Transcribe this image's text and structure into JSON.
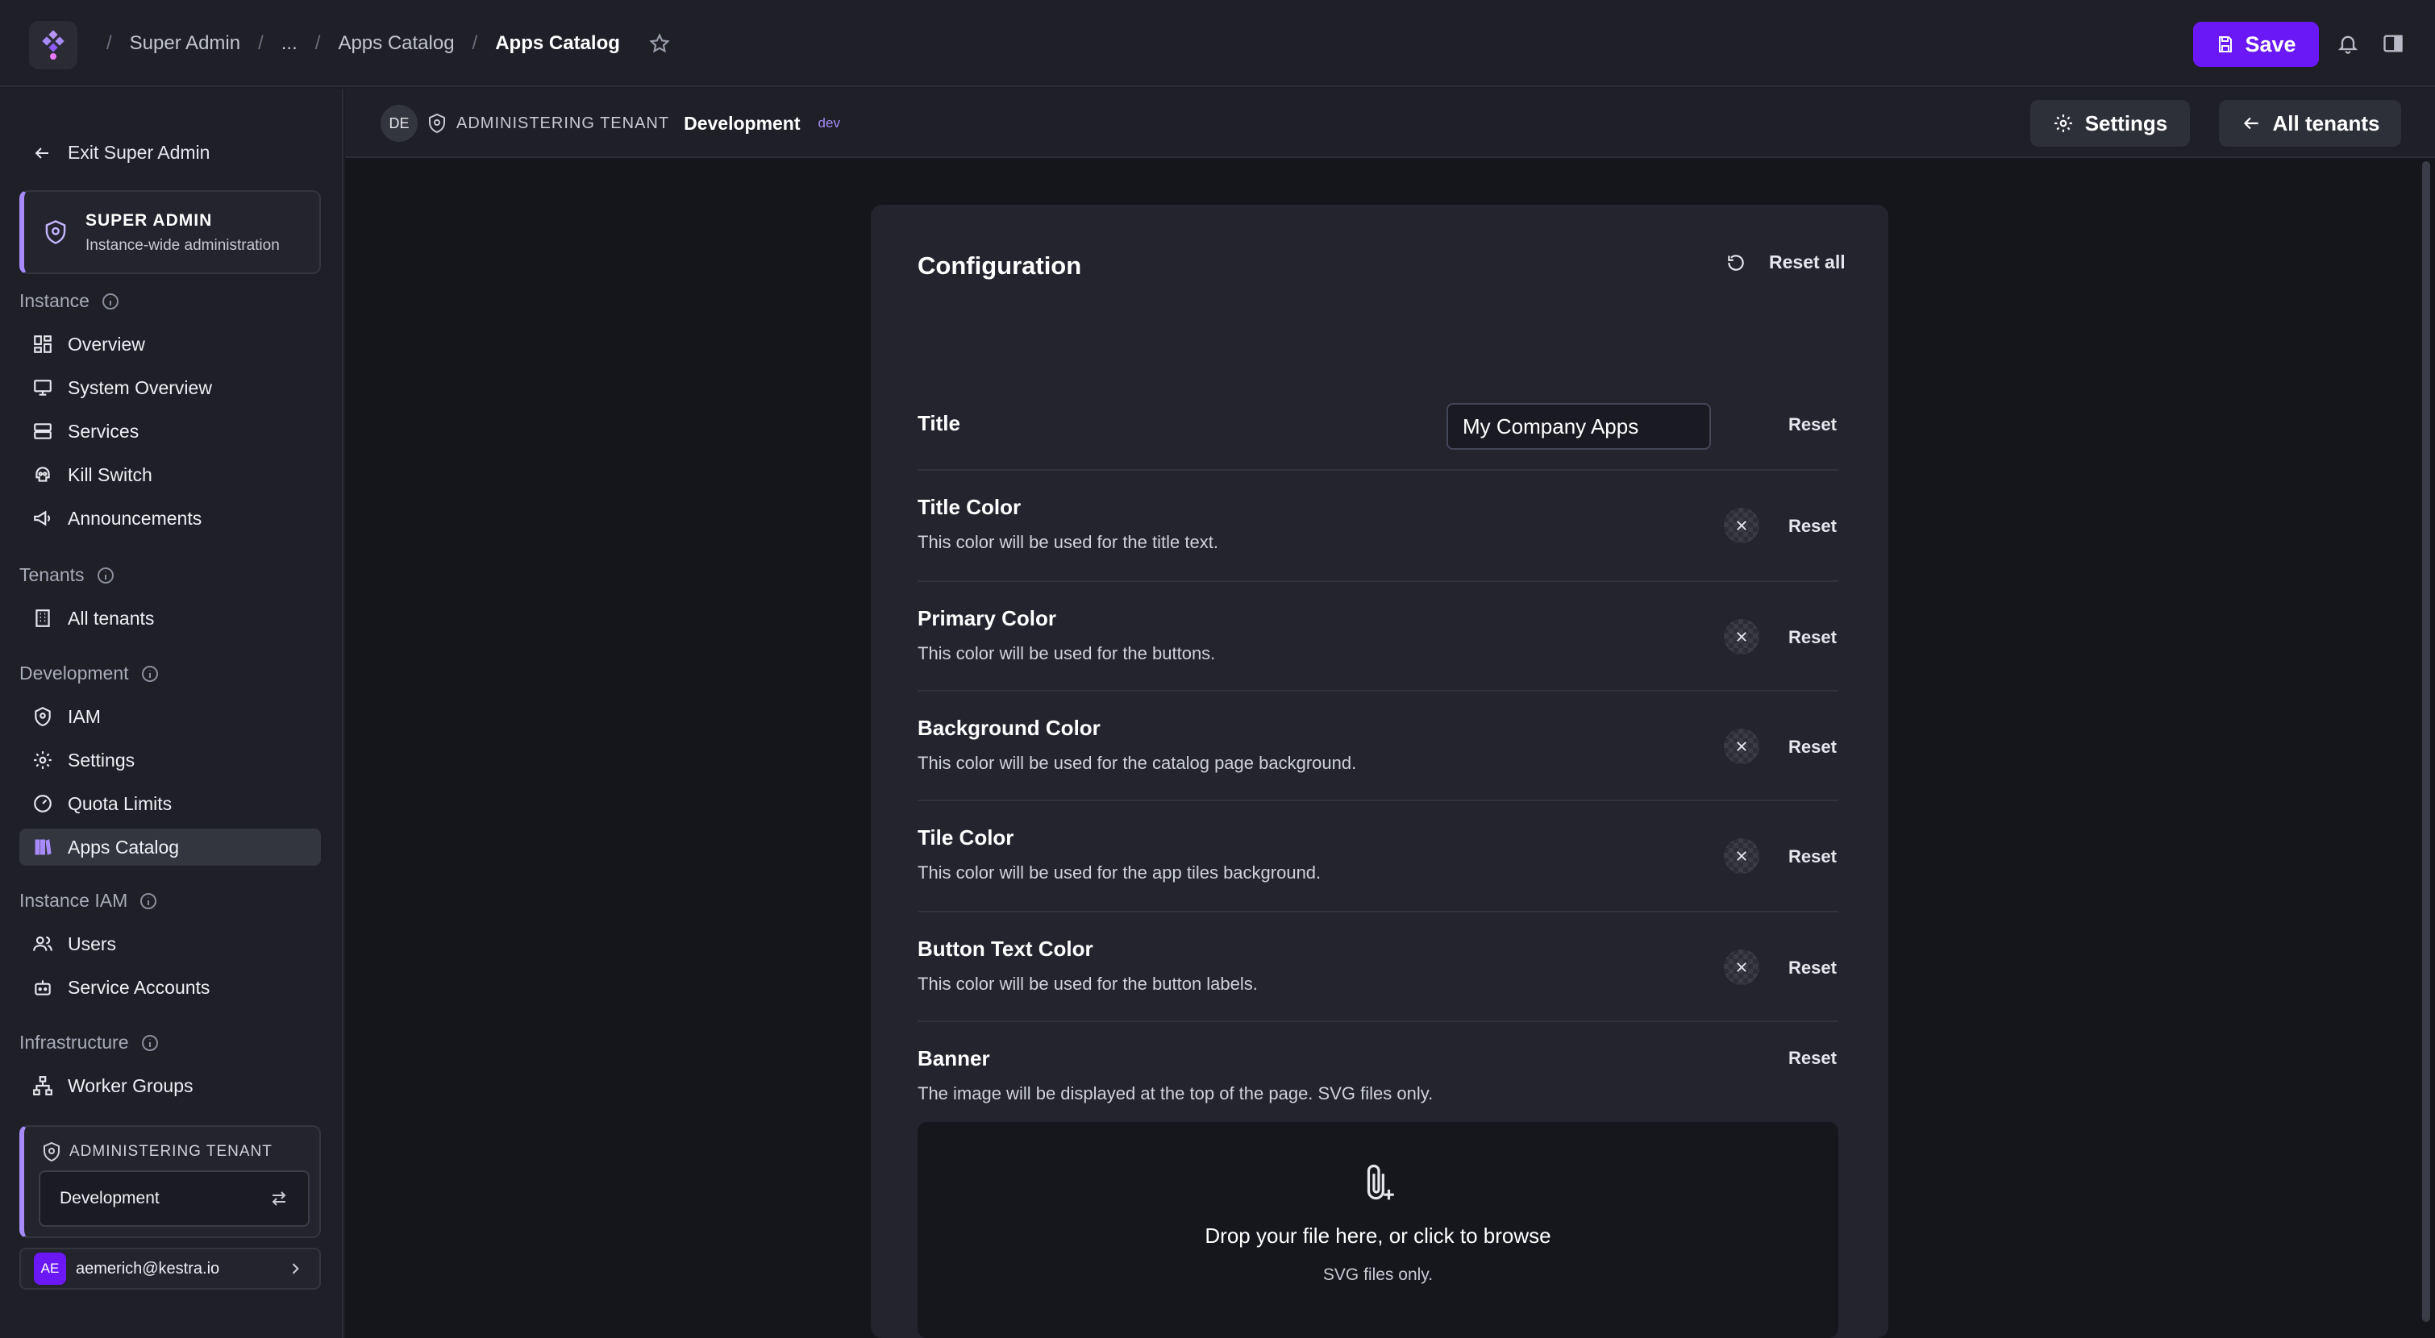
{
  "topbar": {
    "breadcrumbs": [
      "Super Admin",
      "...",
      "Apps Catalog",
      "Apps Catalog"
    ],
    "save_label": "Save"
  },
  "sidebar": {
    "exit_label": "Exit Super Admin",
    "super_admin": {
      "title": "SUPER ADMIN",
      "subtitle": "Instance-wide administration"
    },
    "sections": {
      "instance": "Instance",
      "tenants": "Tenants",
      "development": "Development",
      "instance_iam": "Instance IAM",
      "infrastructure": "Infrastructure"
    },
    "items": {
      "overview": "Overview",
      "system_overview": "System Overview",
      "services": "Services",
      "kill_switch": "Kill Switch",
      "announcements": "Announcements",
      "all_tenants": "All tenants",
      "iam": "IAM",
      "settings": "Settings",
      "quota_limits": "Quota Limits",
      "apps_catalog": "Apps Catalog",
      "users": "Users",
      "service_accounts": "Service Accounts",
      "worker_groups": "Worker Groups"
    },
    "tenant_box": {
      "heading": "ADMINISTERING TENANT",
      "selected": "Development"
    },
    "user": {
      "initials": "AE",
      "email": "aemerich@kestra.io"
    }
  },
  "subheader": {
    "tenant_initials": "DE",
    "label": "ADMINISTERING TENANT",
    "tenant_name": "Development",
    "tenant_tag": "dev",
    "settings_label": "Settings",
    "all_tenants_label": "All tenants"
  },
  "config": {
    "title": "Configuration",
    "reset_all": "Reset all",
    "reset_label": "Reset",
    "title_row": {
      "label": "Title",
      "value": "My Company Apps"
    },
    "colors": [
      {
        "label": "Title Color",
        "desc": "This color will be used for the title text."
      },
      {
        "label": "Primary Color",
        "desc": "This color will be used for the buttons."
      },
      {
        "label": "Background Color",
        "desc": "This color will be used for the catalog page background."
      },
      {
        "label": "Tile Color",
        "desc": "This color will be used for the app tiles background."
      },
      {
        "label": "Button Text Color",
        "desc": "This color will be used for the button labels."
      }
    ],
    "banner": {
      "label": "Banner",
      "desc": "The image will be displayed at the top of the page. SVG files only.",
      "drop_text": "Drop your file here, or click to browse",
      "drop_sub": "SVG files only."
    }
  },
  "colors": {
    "accent": "#6a18f5",
    "accent_light": "#a78bfa",
    "background": "#15161c",
    "card": "#23242d"
  },
  "icons": [
    "kestra-logo-icon",
    "star-icon",
    "save-icon",
    "bell-icon",
    "panel-toggle-icon",
    "arrow-left-icon",
    "shield-icon",
    "info-icon",
    "dashboard-icon",
    "monitor-icon",
    "server-icon",
    "skull-icon",
    "megaphone-icon",
    "building-icon",
    "gear-icon",
    "gauge-icon",
    "book-icon",
    "users-icon",
    "robot-icon",
    "sitemap-icon",
    "swap-icon",
    "chevron-right-icon",
    "reset-icon",
    "close-icon",
    "paperclip-plus-icon"
  ]
}
